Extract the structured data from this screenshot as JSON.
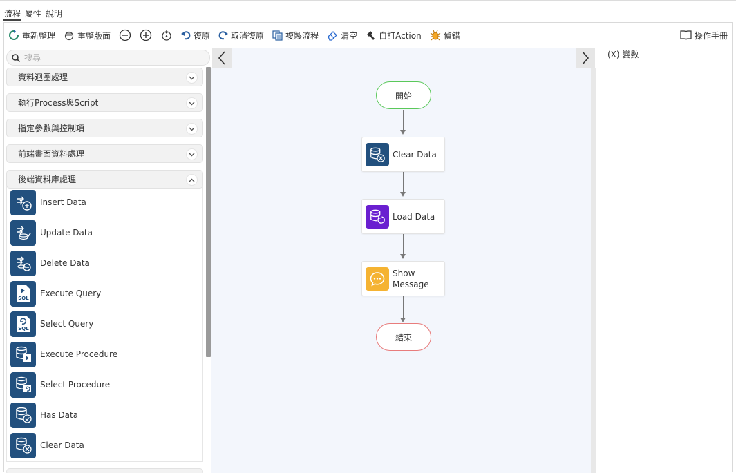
{
  "tabs": [
    {
      "label": "流程"
    },
    {
      "label": "屬性"
    },
    {
      "label": "說明"
    }
  ],
  "toolbar": {
    "refresh": "重新整理",
    "reset_layout": "重整版面",
    "undo": "復原",
    "redo": "取消復原",
    "copy_flow": "複製流程",
    "clear": "清空",
    "custom_action": "自訂Action",
    "debug": "偵錯",
    "manual": "操作手冊"
  },
  "search": {
    "placeholder": "搜尋"
  },
  "categories": [
    {
      "label": "資料迴圈處理"
    },
    {
      "label": "執行Process與Script"
    },
    {
      "label": "指定參數與控制項"
    },
    {
      "label": "前端畫面資料處理"
    },
    {
      "label": "後端資料庫處理"
    }
  ],
  "items": [
    {
      "label": "Insert Data",
      "icon": "db-insert-icon"
    },
    {
      "label": "Update Data",
      "icon": "db-update-icon"
    },
    {
      "label": "Delete Data",
      "icon": "db-delete-icon"
    },
    {
      "label": "Execute Query",
      "icon": "sql-execute-icon"
    },
    {
      "label": "Select Query",
      "icon": "sql-select-icon"
    },
    {
      "label": "Execute Procedure",
      "icon": "procedure-execute-icon"
    },
    {
      "label": "Select Procedure",
      "icon": "procedure-select-icon"
    },
    {
      "label": "Has Data",
      "icon": "db-check-icon"
    },
    {
      "label": "Clear Data",
      "icon": "db-clear-icon"
    }
  ],
  "flow": {
    "start": "開始",
    "nodes": [
      {
        "label": "Clear Data",
        "color": "#22507e"
      },
      {
        "label": "Load Data",
        "color": "#6a1fd0"
      },
      {
        "label": "Show Message",
        "color": "#f5b332"
      }
    ],
    "end": "結束"
  },
  "variables": {
    "label": "(X) 變數"
  },
  "colors": {
    "accent": "#22507e",
    "start_border": "#5ac85a",
    "end_border": "#e87c7c",
    "canvas_bg": "#f3f6fc"
  }
}
